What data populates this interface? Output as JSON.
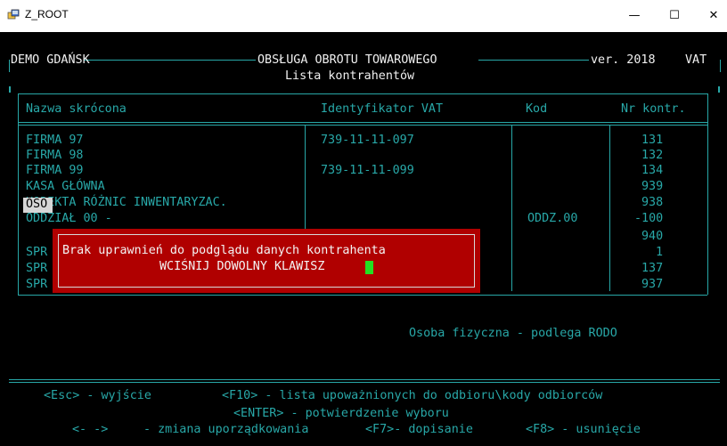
{
  "window": {
    "title": "Z_ROOT",
    "minimize_glyph": "—",
    "maximize_glyph": "☐",
    "close_glyph": "✕"
  },
  "header": {
    "company": "DEMO GDAŃSK",
    "module": "OBSŁUGA OBROTU TOWAROWEGO",
    "version": "ver. 2018",
    "vat": "VAT",
    "subtitle": "Lista kontrahentów"
  },
  "table": {
    "columns": [
      "Nazwa skrócona",
      "Identyfikator VAT",
      "Kod",
      "Nr kontr."
    ],
    "rows": [
      {
        "name": "FIRMA 97",
        "vat": "739-11-11-097",
        "code": "",
        "nr": "131"
      },
      {
        "name": "FIRMA 98",
        "vat": "",
        "code": "",
        "nr": "132"
      },
      {
        "name": "FIRMA 99",
        "vat": "739-11-11-099",
        "code": "",
        "nr": "134"
      },
      {
        "name": "KASA GŁÓWNA",
        "vat": "",
        "code": "",
        "nr": "939"
      },
      {
        "name": "KOREKTA RÓŻNIC INWENTARYZAC.",
        "vat": "",
        "code": "",
        "nr": "938"
      },
      {
        "name": "ODDZIAŁ 00 -",
        "vat": "",
        "code": "ODDZ.00",
        "nr": "-100"
      },
      {
        "name": "OSO",
        "vat": "",
        "code": "",
        "nr": "940"
      },
      {
        "name": "SPR",
        "vat": "",
        "code": "",
        "nr": "1"
      },
      {
        "name": "SPR",
        "vat": "",
        "code": "",
        "nr": "137"
      },
      {
        "name": "SPR",
        "vat": "",
        "code": "",
        "nr": "937"
      }
    ]
  },
  "dialog": {
    "message": "Brak uprawnień do podglądu danych kontrahenta",
    "prompt": "WCIŚNIJ DOWOLNY KLAWISZ"
  },
  "status": {
    "note": "Osoba fizyczna - podlega RODO"
  },
  "footer": {
    "esc": "<Esc> - wyjście",
    "f10": "<F10> - lista upoważnionych do odbioru\\kody odbiorców",
    "enter": "<ENTER> - potwierdzenie wyboru",
    "arrows": "<- ->",
    "sort": "- zmiana uporządkowania",
    "f7": "<F7>- dopisanie",
    "f8": "<F8> - usunięcie"
  },
  "colors": {
    "terminal_bg": "#000000",
    "terminal_fg": "#28a8a8",
    "dialog_bg": "#b00000",
    "cursor": "#22e022",
    "selection": "#d6d6d6"
  }
}
